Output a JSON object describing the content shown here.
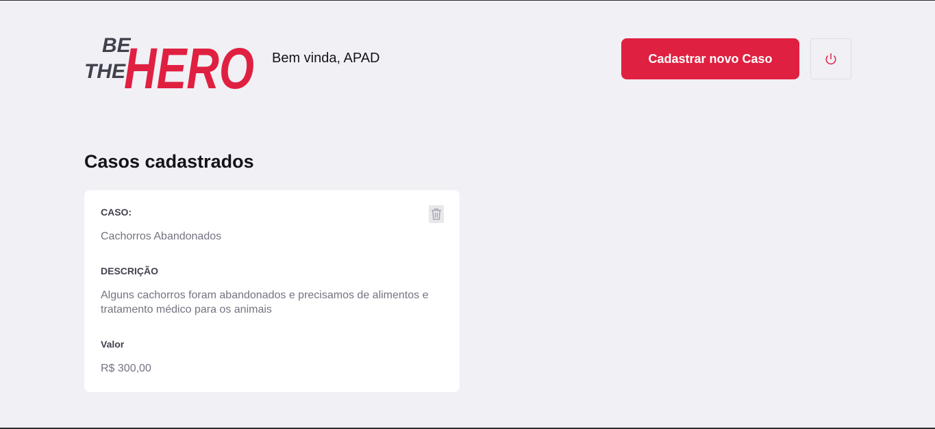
{
  "header": {
    "logo_text": [
      "BE",
      "THE",
      "HERO"
    ],
    "welcome": "Bem vinda, APAD",
    "new_case_label": "Cadastrar novo Caso",
    "logout_icon": "power-icon"
  },
  "main": {
    "title": "Casos cadastrados",
    "cases": [
      {
        "case_label": "CASO:",
        "case_value": "Cachorros Abandonados",
        "description_label": "DESCRIÇÃO",
        "description_value": "Alguns cachorros foram abandonados e precisamos de alimentos e tratamento médico para os animais",
        "value_label": "Valor",
        "value_value": "R$ 300,00",
        "delete_icon": "trash-icon"
      }
    ]
  },
  "colors": {
    "accent": "#e02041",
    "background": "#f0f0f5",
    "dark_text": "#41414d",
    "light_text": "#737380"
  }
}
